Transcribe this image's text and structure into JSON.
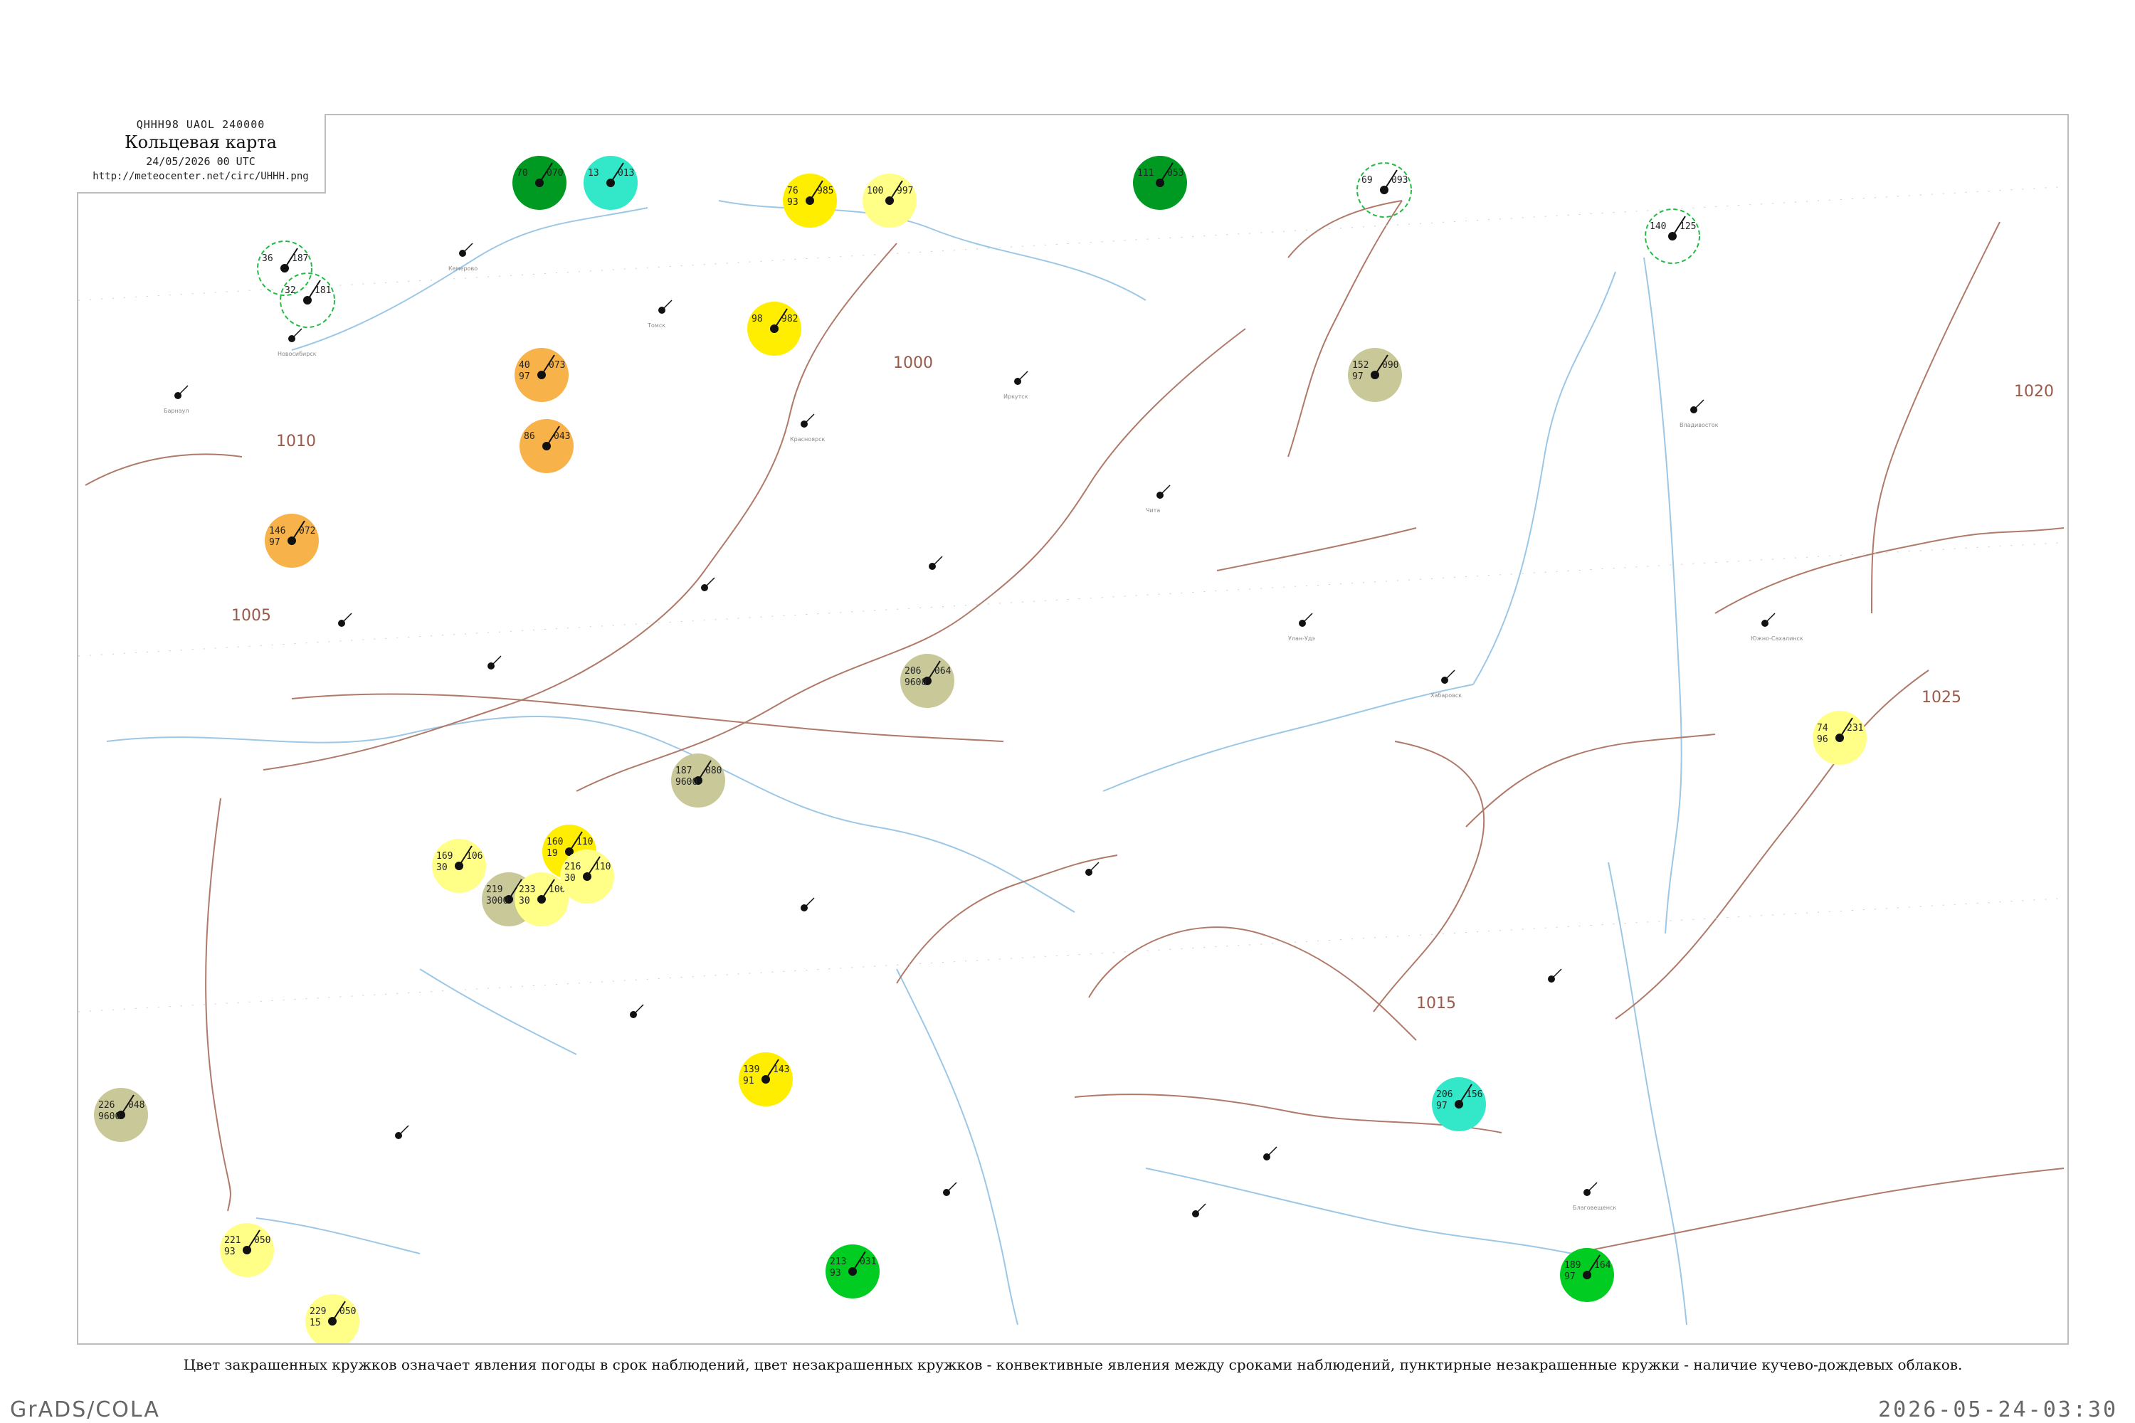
{
  "header": {
    "code": "QHHH98  UAOL  240000",
    "title": "Кольцевая карта",
    "date": "24/05/2026 00 UTC",
    "url": "http://meteocenter.net/circ/UHHH.png"
  },
  "caption": "Цвет закрашенных кружков означает явления погоды в срок наблюдений, цвет незакрашенных кружков - конвективные явления между сроками наблюдений, пунктирные незакрашенные кружки - наличие кучево-дождевых облаков.",
  "footer": {
    "left": "GrADS/COLA",
    "right": "2026-05-24-03:30"
  },
  "colors": {
    "isobar": "#b07a6a",
    "river": "#9cc7e6",
    "rain_green": "#00cc22",
    "dark_green": "#009922",
    "fog_yellow": "#ffee00",
    "light_yellow": "#ffff88",
    "haze_olive": "#c8c898",
    "smoke_orange": "#f7b24a",
    "teal": "#33e8c8",
    "dashed_green": "#22bb44"
  },
  "isobars": [
    {
      "label": "1000"
    },
    {
      "label": "1005"
    },
    {
      "label": "1010"
    },
    {
      "label": "1015"
    },
    {
      "label": "1020"
    },
    {
      "label": "1025"
    }
  ],
  "stations": [
    {
      "t": "36",
      "n": "",
      "p": "187",
      "c": "none"
    },
    {
      "t": "32",
      "n": "",
      "p": "181",
      "c": "none"
    },
    {
      "t": "70",
      "n": "",
      "p": "070",
      "c": "dgreen"
    },
    {
      "t": "13",
      "n": "",
      "p": "013",
      "c": "teal"
    },
    {
      "t": "76",
      "n": "93",
      "p": "985",
      "c": "yellow"
    },
    {
      "t": "100",
      "n": "",
      "p": "997",
      "c": "lyellow"
    },
    {
      "t": "111",
      "n": "",
      "p": "053",
      "c": "dgreen"
    },
    {
      "t": "69",
      "n": "",
      "p": "093",
      "c": "none"
    },
    {
      "t": "140",
      "n": "",
      "p": "125",
      "c": "none"
    },
    {
      "t": "98",
      "n": "",
      "p": "982",
      "c": "yellow"
    },
    {
      "t": "40",
      "n": "97",
      "p": "073",
      "c": "orange"
    },
    {
      "t": "86",
      "n": "",
      "p": "043",
      "c": "orange"
    },
    {
      "t": "146",
      "n": "97",
      "p": "072",
      "c": "orange"
    },
    {
      "t": "152",
      "n": "97",
      "p": "090",
      "c": "olive"
    },
    {
      "t": "206",
      "n": "9600",
      "p": "064",
      "c": "olive"
    },
    {
      "t": "74",
      "n": "96",
      "p": "231",
      "c": "lyellow"
    },
    {
      "t": "187",
      "n": "9600",
      "p": "080",
      "c": "olive"
    },
    {
      "t": "160",
      "n": "19",
      "p": "110",
      "c": "yellow"
    },
    {
      "t": "169",
      "n": "30",
      "p": "106",
      "c": "lyellow"
    },
    {
      "t": "219",
      "n": "3000",
      "p": "098",
      "c": "olive"
    },
    {
      "t": "233",
      "n": "30",
      "p": "106",
      "c": "lyellow"
    },
    {
      "t": "216",
      "n": "30",
      "p": "110",
      "c": "lyellow"
    },
    {
      "t": "139",
      "n": "91",
      "p": "143",
      "c": "yellow"
    },
    {
      "t": "206",
      "n": "97",
      "p": "156",
      "c": "teal"
    },
    {
      "t": "226",
      "n": "9600",
      "p": "048",
      "c": "olive"
    },
    {
      "t": "221",
      "n": "93",
      "p": "050",
      "c": "lyellow"
    },
    {
      "t": "213",
      "n": "93",
      "p": "031",
      "c": "green"
    },
    {
      "t": "229",
      "n": "15",
      "p": "050",
      "c": "lyellow"
    },
    {
      "t": "189",
      "n": "97",
      "p": "164",
      "c": "green"
    }
  ],
  "station_names": [
    "Новосибирск",
    "Барнаул",
    "Кемерово",
    "Томск",
    "Красноярск",
    "Иркутск",
    "Чита",
    "Улан-Удэ",
    "Хабаровск",
    "Благовещенск",
    "Владивосток",
    "Южно-Сахалинск"
  ]
}
